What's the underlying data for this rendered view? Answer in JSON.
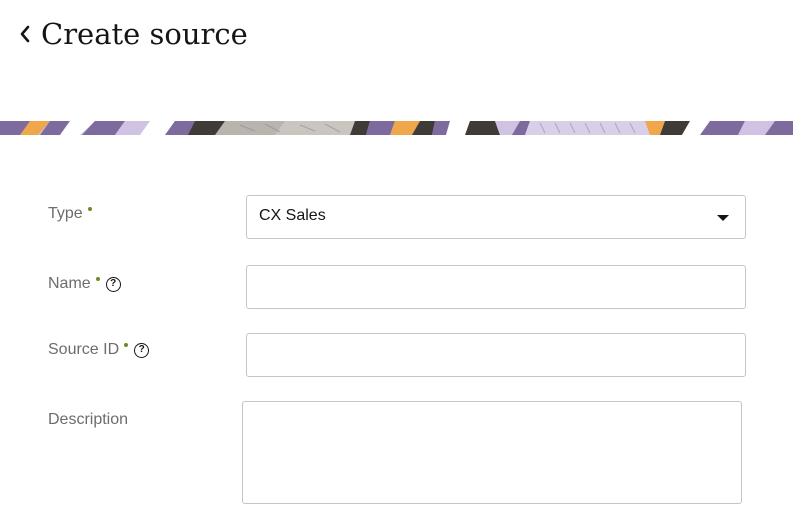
{
  "header": {
    "title": "Create source",
    "back_icon": "chevron-left-icon"
  },
  "colors": {
    "required_dot": "#6b8e23",
    "banner_purple": "#7d6b9e",
    "banner_lavender": "#cfc2e3",
    "banner_orange": "#f0a64a",
    "banner_dark": "#3f3b37",
    "banner_gray": "#b8b4ae"
  },
  "form": {
    "type": {
      "label": "Type",
      "required": true,
      "value": "CX Sales"
    },
    "name": {
      "label": "Name",
      "required": true,
      "help_icon": "help-icon",
      "value": ""
    },
    "source_id": {
      "label": "Source ID",
      "required": true,
      "help_icon": "help-icon",
      "value": ""
    },
    "description": {
      "label": "Description",
      "value": ""
    }
  }
}
